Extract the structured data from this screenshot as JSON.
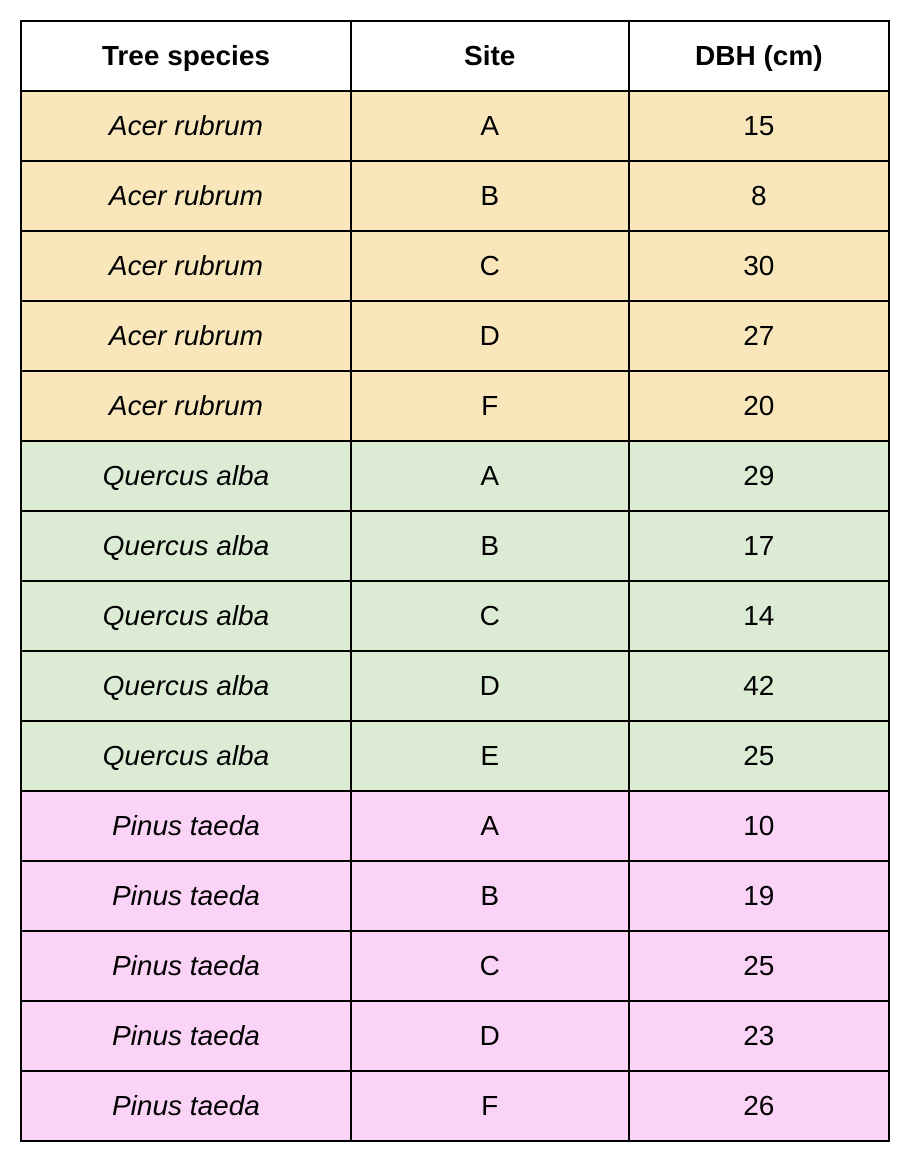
{
  "table": {
    "headers": [
      "Tree species",
      "Site",
      "DBH (cm)"
    ],
    "groups": [
      {
        "color": "#f9e7bb",
        "rows": [
          {
            "species": "Acer rubrum",
            "site": "A",
            "dbh": "15"
          },
          {
            "species": "Acer rubrum",
            "site": "B",
            "dbh": "8"
          },
          {
            "species": "Acer rubrum",
            "site": "C",
            "dbh": "30"
          },
          {
            "species": "Acer rubrum",
            "site": "D",
            "dbh": "27"
          },
          {
            "species": "Acer rubrum",
            "site": "F",
            "dbh": "20"
          }
        ]
      },
      {
        "color": "#dcebd4",
        "rows": [
          {
            "species": "Quercus alba",
            "site": "A",
            "dbh": "29"
          },
          {
            "species": "Quercus alba",
            "site": "B",
            "dbh": "17"
          },
          {
            "species": "Quercus alba",
            "site": "C",
            "dbh": "14"
          },
          {
            "species": "Quercus alba",
            "site": "D",
            "dbh": "42"
          },
          {
            "species": "Quercus alba",
            "site": "E",
            "dbh": "25"
          }
        ]
      },
      {
        "color": "#fad3f6",
        "rows": [
          {
            "species": "Pinus taeda",
            "site": "A",
            "dbh": "10"
          },
          {
            "species": "Pinus taeda",
            "site": "B",
            "dbh": "19"
          },
          {
            "species": "Pinus taeda",
            "site": "C",
            "dbh": "25"
          },
          {
            "species": "Pinus taeda",
            "site": "D",
            "dbh": "23"
          },
          {
            "species": "Pinus taeda",
            "site": "F",
            "dbh": "26"
          }
        ]
      }
    ]
  }
}
